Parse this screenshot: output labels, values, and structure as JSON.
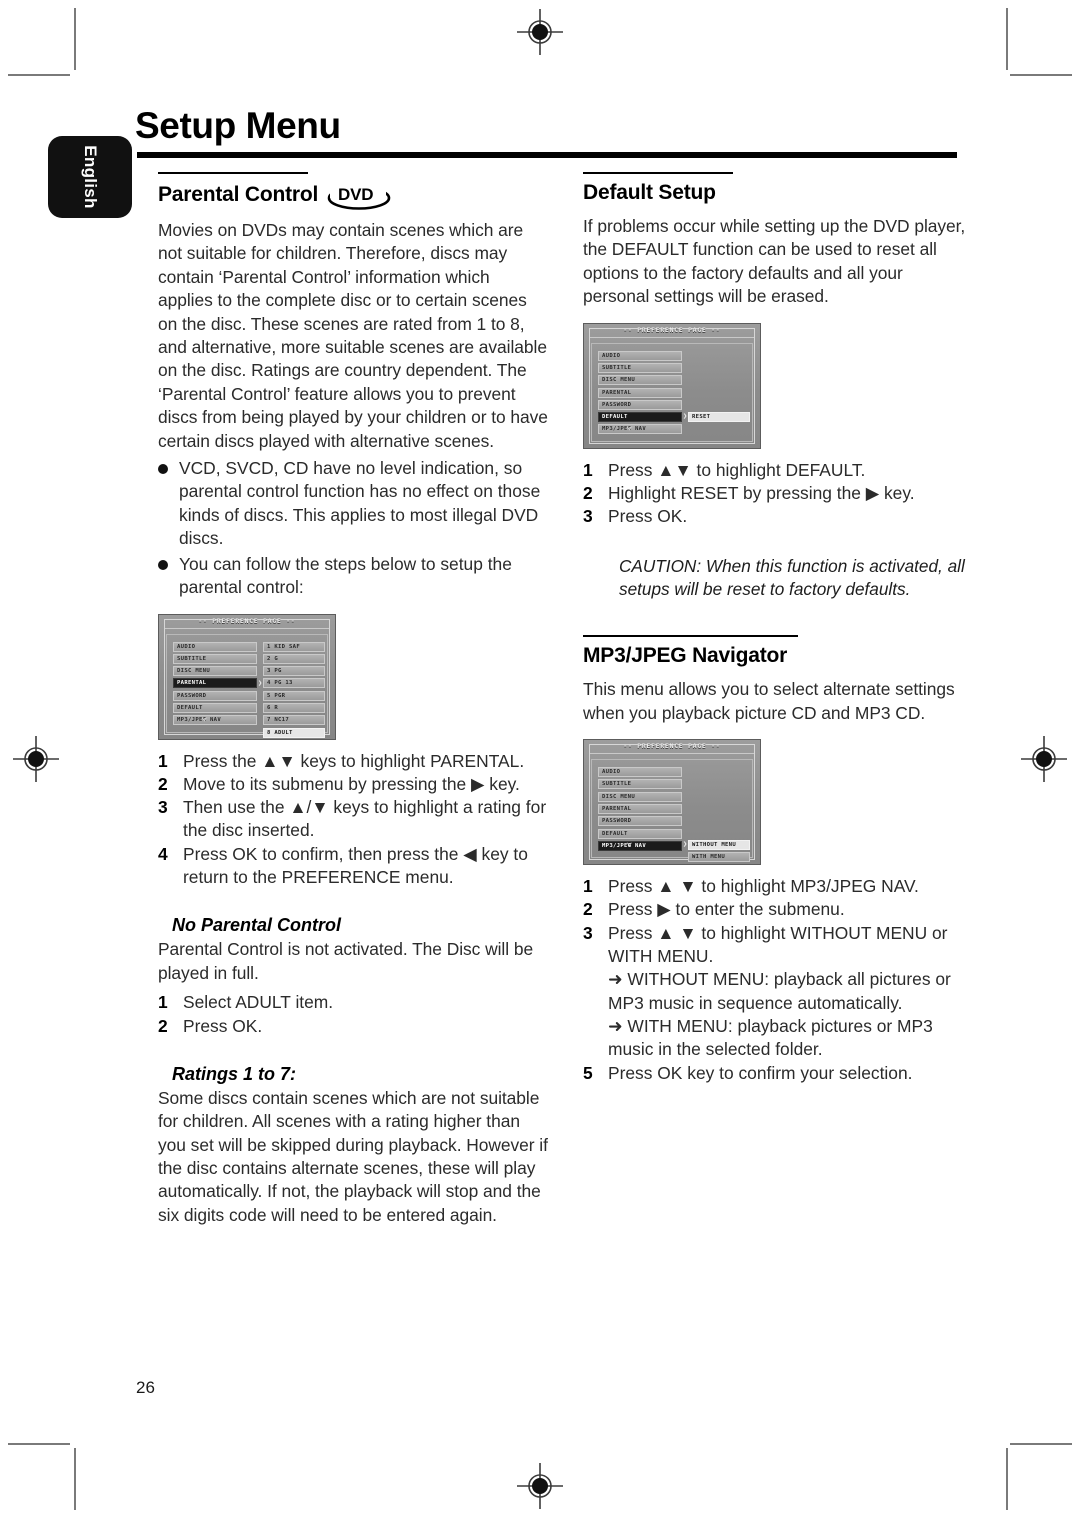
{
  "page": {
    "title": "Setup Menu",
    "language_tab": "English",
    "page_number": "26"
  },
  "left_column": {
    "section_heading": "Parental Control",
    "heading_icon": "dvd-logo-icon",
    "dvd_logo_text": "DVD",
    "intro_paragraph": "Movies on DVDs may contain scenes which are not suitable for children. Therefore, discs may contain ‘Parental Control’ information which applies to the complete disc or to certain scenes on the disc. These scenes are rated from 1 to 8, and alternative, more suitable scenes are available on the disc. Ratings are country dependent. The ‘Parental Control’ feature allows you to prevent discs from being played by your children or to have certain discs played with alternative scenes.",
    "bullets": [
      "VCD, SVCD, CD have no level indication, so parental control function has no effect on those kinds of discs. This applies to most illegal DVD discs.",
      "You can follow the steps below to setup the parental control:"
    ],
    "osd_parental": {
      "title": "-- PREFERENCE PAGE --",
      "menu_items": [
        "AUDIO",
        "SUBTITLE",
        "DISC MENU",
        "PARENTAL",
        "PASSWORD",
        "DEFAULT",
        "MP3/JPEG NAV"
      ],
      "selected_item": "PARENTAL",
      "submenu_items": [
        "1 KID SAF",
        "2 G",
        "3 PG",
        "4 PG 13",
        "5 PGR",
        "6 R",
        "7 NC17",
        "8 ADULT"
      ],
      "submenu_highlighted": "8 ADULT",
      "scroll_chevron": "chevron-down-icon"
    },
    "steps": [
      {
        "num": "1",
        "text": "Press the ▲▼ keys to highlight PARENTAL."
      },
      {
        "num": "2",
        "text": "Move to its submenu by pressing the ▶ key."
      },
      {
        "num": "3",
        "text": "Then use the ▲/▼ keys to highlight a rating for the disc inserted."
      },
      {
        "num": "4",
        "text": "Press OK to confirm, then press the ◀ key to return to the PREFERENCE menu."
      }
    ],
    "no_parental_heading": "No Parental Control",
    "no_parental_text": "Parental Control is not activated. The Disc will be played in full.",
    "no_parental_steps": [
      {
        "num": "1",
        "text": "Select ADULT item."
      },
      {
        "num": "2",
        "text": "Press OK."
      }
    ],
    "ratings_heading": "Ratings 1 to 7:",
    "ratings_text": "Some discs contain scenes which are not suitable for children. All scenes with a rating higher than you set will be skipped during playback. However if the disc contains alternate scenes, these will play automatically. If not, the playback will stop and the six digits code will need to be entered again."
  },
  "right_column": {
    "default_setup": {
      "heading": "Default Setup",
      "paragraph": "If problems occur while setting up the DVD player, the DEFAULT function can be used to reset all options to the factory defaults and all your personal settings will be erased.",
      "osd": {
        "title": "-- PREFERENCE PAGE --",
        "menu_items": [
          "AUDIO",
          "SUBTITLE",
          "DISC MENU",
          "PARENTAL",
          "PASSWORD",
          "DEFAULT",
          "MP3/JPEG NAV"
        ],
        "selected_item": "DEFAULT",
        "submenu_items": [
          "RESET"
        ],
        "submenu_highlighted": "RESET",
        "scroll_chevron": "chevron-down-icon"
      },
      "steps": [
        {
          "num": "1",
          "text": "Press ▲▼ to highlight DEFAULT."
        },
        {
          "num": "2",
          "text": "Highlight RESET by pressing the ▶  key."
        },
        {
          "num": "3",
          "text": "Press OK."
        }
      ],
      "caution": "CAUTION: When this function is activated, all setups will be reset to factory defaults."
    },
    "mp3_jpeg": {
      "heading": "MP3/JPEG Navigator",
      "paragraph": "This menu allows you to select alternate settings when you playback picture CD and MP3 CD.",
      "osd": {
        "title": "-- PREFERENCE PAGE --",
        "menu_items": [
          "AUDIO",
          "SUBTITLE",
          "DISC MENU",
          "PARENTAL",
          "PASSWORD",
          "DEFAULT",
          "MP3/JPEG NAV"
        ],
        "selected_item": "MP3/JPEG NAV",
        "submenu_items": [
          "WITHOUT MENU",
          "WITH MENU"
        ],
        "submenu_highlighted": "WITHOUT MENU",
        "scroll_chevron": "chevron-down-icon"
      },
      "steps": [
        {
          "num": "1",
          "text": "Press ▲ ▼ to highlight MP3/JPEG NAV."
        },
        {
          "num": "2",
          "text": "Press ▶ to enter the submenu."
        },
        {
          "num": "3",
          "text": "Press ▲ ▼ to highlight WITHOUT MENU or WITH MENU."
        },
        {
          "num": "5",
          "text": "Press OK key to confirm your selection."
        }
      ],
      "sub_notes": [
        "➜ WITHOUT MENU:  playback all pictures or MP3 music in sequence automatically.",
        "➜ WITH MENU: playback pictures or MP3 music in the selected folder."
      ]
    }
  },
  "colors": {
    "text": "#2b2b2b",
    "heading": "#000000",
    "tab_bg": "#111111",
    "osd_bg": "#8c8c8c",
    "osd_selected": "#1b1b1b",
    "osd_highlight": "#e6e6e6"
  }
}
